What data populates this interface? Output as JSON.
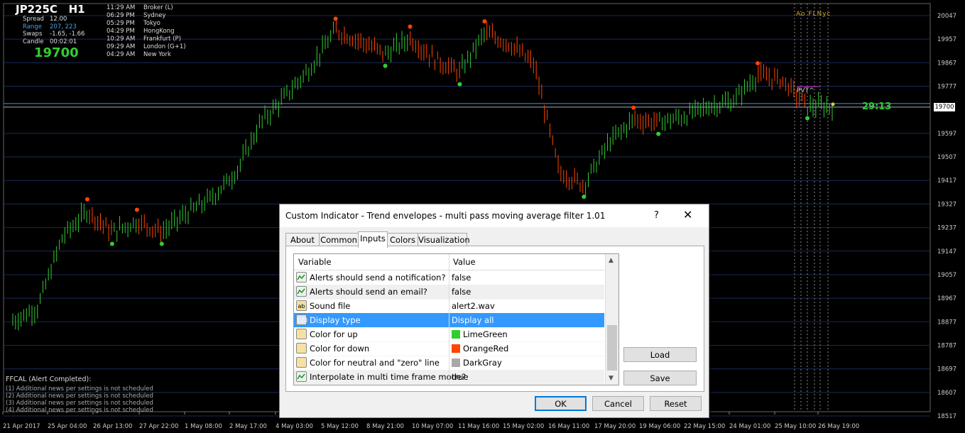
{
  "chart": {
    "symbol": "JP225C",
    "timeframe": "H1",
    "stats": [
      {
        "key": "Spread",
        "value": "12.00"
      },
      {
        "key": "Range",
        "value": "207, 223"
      },
      {
        "key": "Swaps",
        "value": "-1.65, -1.66"
      },
      {
        "key": "Candle",
        "value": "00:02:01"
      }
    ],
    "big_price": "19700",
    "sessions": [
      {
        "time": "11:29 AM",
        "name": "Broker (L)"
      },
      {
        "time": "06:29 PM",
        "name": "Sydney"
      },
      {
        "time": "05:29 PM",
        "name": "Tokyo"
      },
      {
        "time": "04:29 PM",
        "name": "HongKong"
      },
      {
        "time": "10:29 AM",
        "name": "Frankfurt (P)"
      },
      {
        "time": "09:29 AM",
        "name": "London (G+1)"
      },
      {
        "time": "04:29 AM",
        "name": "New York"
      }
    ],
    "news_title": "FFCAL (Alert Completed):",
    "news": [
      "(1) Additional news per settings is not scheduled",
      "(2) Additional news per settings is not scheduled",
      "(3) Additional news per settings is not scheduled",
      "(4) Additional news per settings is not scheduled"
    ],
    "countdown": "29:13",
    "pivot_label": "PVT^",
    "session_labels": "Ao FLNyc",
    "current_price": "19700",
    "colors": {
      "up": "#32cd32",
      "down": "#ff4500",
      "grid": "#1a2a55",
      "bid_line": "#4a90e2"
    }
  },
  "chart_data": {
    "type": "line",
    "x": [
      "21 Apr 2017",
      "25 Apr 04:00",
      "26 Apr 13:00",
      "27 Apr 22:00",
      "1 May 08:00",
      "2 May 17:00",
      "4 May 03:00",
      "5 May 12:00",
      "8 May 21:00",
      "10 May 07:00",
      "11 May 16:00",
      "15 May 02:00",
      "16 May 11:00",
      "17 May 20:00",
      "19 May 06:00",
      "22 May 15:00",
      "24 May 01:00",
      "25 May 10:00",
      "26 May 19:00"
    ],
    "y_ticks": [
      "20047",
      "19957",
      "19867",
      "19777",
      "19700",
      "19597",
      "19507",
      "19417",
      "19327",
      "19237",
      "19147",
      "19057",
      "18967",
      "18877",
      "18787",
      "18697",
      "18607",
      "18517"
    ],
    "ylim": [
      18517,
      20047
    ],
    "series": [
      {
        "values": [
          18880,
          18930,
          19200,
          19300,
          19220,
          19260,
          19220,
          19290,
          19350,
          19450,
          19640,
          19740,
          19850,
          19990,
          19950,
          19900,
          19960,
          19880,
          19830,
          19980,
          19940,
          19860,
          19450,
          19400,
          19560,
          19650,
          19640,
          19660,
          19700,
          19720,
          19820,
          19800,
          19700,
          19700
        ]
      }
    ]
  },
  "dialog": {
    "title": "Custom Indicator - Trend envelopes - multi pass moving average filter 1.01",
    "help": "?",
    "close": "✕",
    "tabs": [
      "About",
      "Common",
      "Inputs",
      "Colors",
      "Visualization"
    ],
    "active_tab": "Inputs",
    "columns": [
      "Variable",
      "Value"
    ],
    "rows": [
      {
        "icon": "bool",
        "name": "Alerts should send a notification?",
        "value": "false"
      },
      {
        "icon": "bool",
        "name": "Alerts should send an email?",
        "value": "false"
      },
      {
        "icon": "ab",
        "name": "Sound file",
        "value": "alert2.wav"
      },
      {
        "icon": "123",
        "name": "Display type",
        "value": "Display all"
      },
      {
        "icon": "color",
        "name": "Color for up",
        "value": "LimeGreen",
        "swatch": "#32cd32"
      },
      {
        "icon": "color",
        "name": "Color for down",
        "value": "OrangeRed",
        "swatch": "#ff4500"
      },
      {
        "icon": "color",
        "name": "Color for neutral and \"zero\" line",
        "value": "DarkGray",
        "swatch": "#a9a9a9"
      },
      {
        "icon": "bool",
        "name": "Interpolate in multi time frame mode?",
        "value": "true"
      }
    ],
    "icon_text": {
      "ab": "ab",
      "123": "123"
    },
    "buttons": {
      "load": "Load",
      "save": "Save",
      "ok": "OK",
      "cancel": "Cancel",
      "reset": "Reset"
    }
  }
}
